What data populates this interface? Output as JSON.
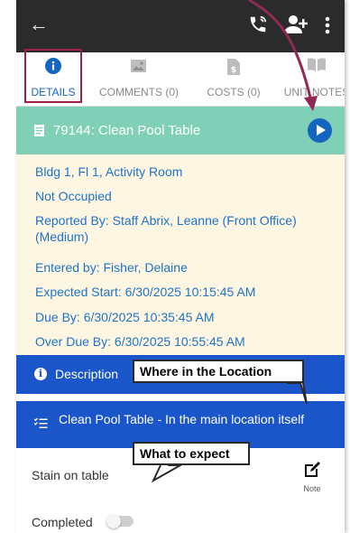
{
  "tabs": [
    {
      "label": "DETAILS",
      "icon": "info-circle-icon",
      "active": true
    },
    {
      "label": "COMMENTS (0)",
      "icon": "image-icon",
      "active": false
    },
    {
      "label": "COSTS (0)",
      "icon": "dollar-file-icon",
      "active": false
    },
    {
      "label": "UNIT NOTES",
      "icon": "book-icon",
      "active": false
    }
  ],
  "work_order": {
    "title": "79144: Clean Pool Table",
    "details": [
      "Bldg 1, Fl 1, Activity Room",
      "Not Occupied",
      "Reported By: Staff Abrix, Leanne (Front Office) (Medium)",
      "Entered by: Fisher, Delaine",
      "Expected Start: 6/30/2025 10:15:45 AM",
      "Due By: 6/30/2025 10:35:45 AM",
      "Over Due By: 6/30/2025 10:55:45 AM"
    ]
  },
  "description": {
    "label": "Description",
    "text": "Clean Pool Table - In the main location itself"
  },
  "tasks": {
    "task_label": "Stain on table",
    "note_label": "Note",
    "completed_label": "Completed",
    "completed": false
  },
  "callouts": {
    "location": "Where in the Location",
    "expect": "What to expect"
  },
  "colors": {
    "topbar": "#2b2b2b",
    "header_green": "#7fd0b7",
    "details_bg": "#fdf6e2",
    "detail_text": "#1e73c8",
    "blue_bar": "#1a56c9",
    "highlight": "#9b2244"
  }
}
